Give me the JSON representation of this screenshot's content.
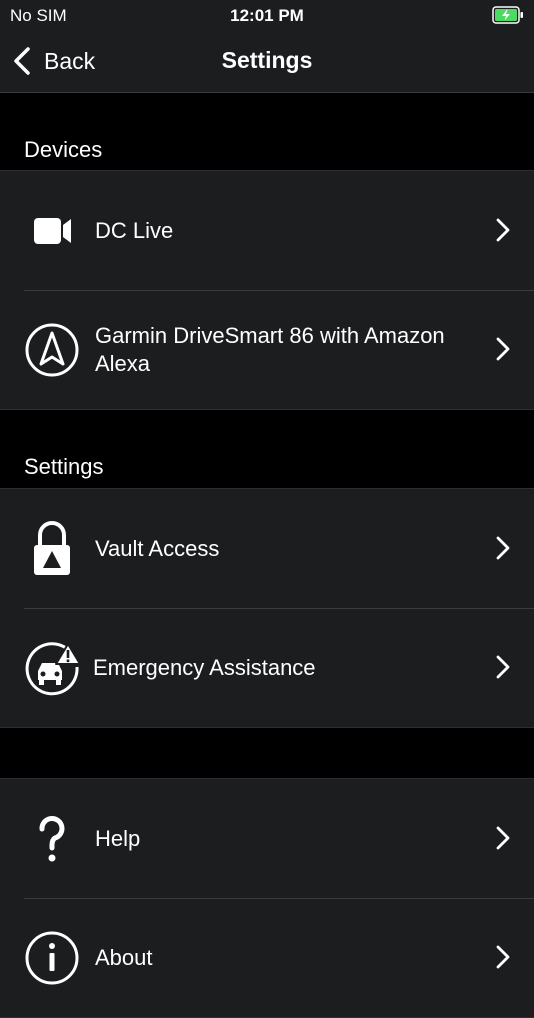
{
  "status_bar": {
    "carrier": "No SIM",
    "time": "12:01 PM",
    "battery_color": "#4cd964"
  },
  "nav_bar": {
    "back_label": "Back",
    "title": "Settings"
  },
  "sections": {
    "devices": {
      "header": "Devices",
      "items": [
        {
          "label": "DC Live",
          "icon": "video-camera-icon"
        },
        {
          "label": "Garmin DriveSmart 86 with Amazon Alexa",
          "icon": "navigation-arrow-icon"
        }
      ]
    },
    "settings": {
      "header": "Settings",
      "items": [
        {
          "label": "Vault Access",
          "icon": "lock-icon"
        },
        {
          "label": "Emergency Assistance",
          "icon": "car-crash-alert-icon"
        }
      ]
    },
    "other": {
      "header": "",
      "items": [
        {
          "label": "Help",
          "icon": "question-mark-icon"
        },
        {
          "label": "About",
          "icon": "info-icon"
        }
      ]
    }
  },
  "colors": {
    "background": "#000000",
    "group_background": "#1c1d1f",
    "separator": "#3a3b3e",
    "text": "#ffffff"
  }
}
